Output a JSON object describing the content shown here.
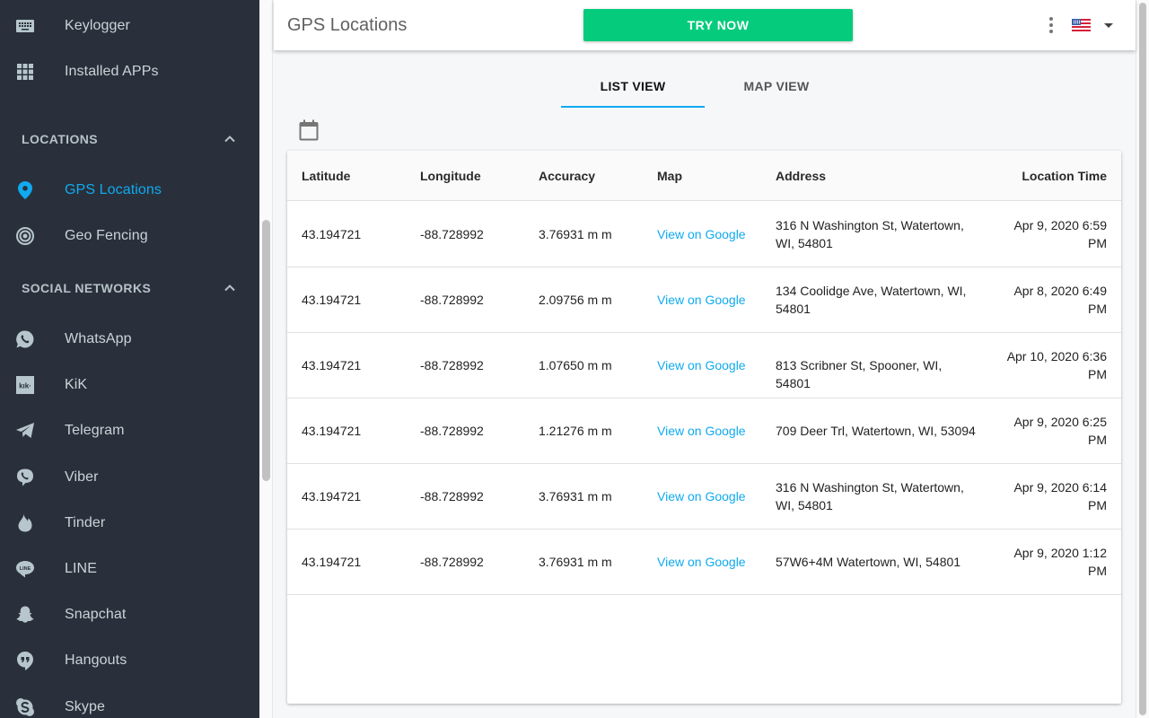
{
  "sidebar": {
    "items_top": [
      {
        "label": "Keylogger",
        "icon": "keyboard-icon"
      },
      {
        "label": "Installed APPs",
        "icon": "apps-grid-icon"
      }
    ],
    "sections": [
      {
        "title": "LOCATIONS",
        "expanded": true,
        "items": [
          {
            "label": "GPS Locations",
            "icon": "location-pin-icon",
            "active": true
          },
          {
            "label": "Geo Fencing",
            "icon": "target-icon",
            "active": false
          }
        ]
      },
      {
        "title": "SOCIAL NETWORKS",
        "expanded": true,
        "items": [
          {
            "label": "WhatsApp",
            "icon": "whatsapp-icon"
          },
          {
            "label": "KiK",
            "icon": "kik-icon"
          },
          {
            "label": "Telegram",
            "icon": "telegram-icon"
          },
          {
            "label": "Viber",
            "icon": "viber-icon"
          },
          {
            "label": "Tinder",
            "icon": "tinder-icon"
          },
          {
            "label": "LINE",
            "icon": "line-icon"
          },
          {
            "label": "Snapchat",
            "icon": "snapchat-icon"
          },
          {
            "label": "Hangouts",
            "icon": "hangouts-icon"
          },
          {
            "label": "Skype",
            "icon": "skype-icon"
          }
        ]
      }
    ],
    "kik_glyph": "kık·",
    "line_glyph": "LINE"
  },
  "header": {
    "title": "GPS Locations",
    "cta_label": "TRY NOW",
    "language_flag": "us-flag-icon"
  },
  "tabs": [
    {
      "label": "LIST VIEW",
      "active": true
    },
    {
      "label": "MAP VIEW",
      "active": false
    }
  ],
  "table": {
    "columns": [
      "Latitude",
      "Longitude",
      "Accuracy",
      "Map",
      "Address",
      "Location Time"
    ],
    "rows": [
      {
        "lat": "43.194721",
        "lon": "-88.728992",
        "accuracy": "3.76931 m m",
        "map": "View on Google",
        "address": "316 N Washington St, Watertown, WI, 54801",
        "time": "Apr 9, 2020 6:59 PM"
      },
      {
        "lat": "43.194721",
        "lon": "-88.728992",
        "accuracy": "2.09756 m m",
        "map": "View on Google",
        "address": "134 Coolidge Ave, Watertown, WI, 54801",
        "time": "Apr 8, 2020 6:49 PM"
      },
      {
        "lat": "43.194721",
        "lon": "-88.728992",
        "accuracy": "1.07650 m m",
        "map": "View on Google",
        "address": "813 Scribner St, Spooner, WI, 54801",
        "time": "Apr 10, 2020 6:36 PM"
      },
      {
        "lat": "43.194721",
        "lon": "-88.728992",
        "accuracy": "1.21276 m m",
        "map": "View on Google",
        "address": "709 Deer Trl, Watertown, WI, 53094",
        "time": "Apr 9, 2020 6:25 PM"
      },
      {
        "lat": "43.194721",
        "lon": "-88.728992",
        "accuracy": "3.76931 m m",
        "map": "View on Google",
        "address": "316 N Washington St, Watertown, WI, 54801",
        "time": "Apr 9, 2020 6:14 PM"
      },
      {
        "lat": "43.194721",
        "lon": "-88.728992",
        "accuracy": "3.76931 m m",
        "map": "View on Google",
        "address": "57W6+4M Watertown, WI, 54801",
        "time": "Apr 9, 2020 1:12 PM"
      }
    ]
  },
  "colors": {
    "sidebar_bg": "#2a303b",
    "accent": "#0faaf0",
    "cta": "#05cc7c",
    "icon": "#b6c6cc"
  }
}
